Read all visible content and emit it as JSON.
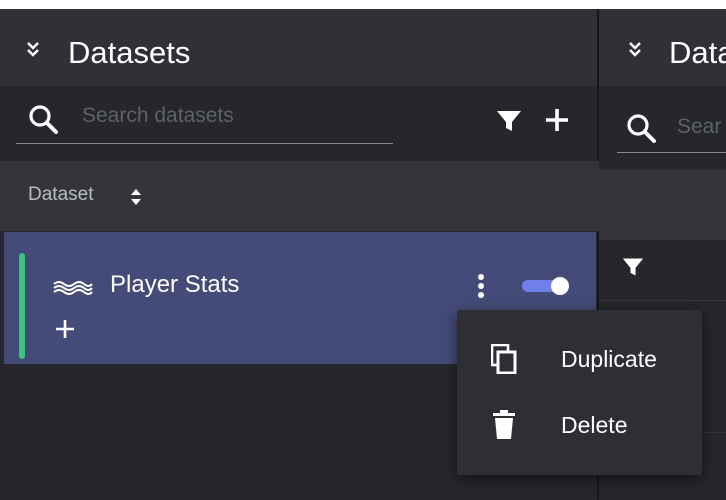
{
  "left_panel": {
    "title": "Datasets",
    "collapse_icon": "chevron-double-down-icon",
    "search": {
      "placeholder": "Search datasets",
      "value": ""
    },
    "column_header": {
      "label": "Dataset",
      "sort_icon": "sort-icon"
    },
    "rows": [
      {
        "label": "Player Stats",
        "icon": "wave-icon",
        "accent_color": "#37c77f",
        "enabled": true,
        "selected": true
      }
    ]
  },
  "right_panel": {
    "title_visible": "Data",
    "search_placeholder_visible": "Sear"
  },
  "context_menu": {
    "items": [
      {
        "label": "Duplicate",
        "icon": "copy-icon"
      },
      {
        "label": "Delete",
        "icon": "trash-icon"
      }
    ]
  },
  "colors": {
    "background": "#1f2126",
    "panel": "#25272c",
    "header": "#2f3136",
    "selected_row": "#454b78",
    "accent": "#37c77f",
    "toggle": "#6f80e8"
  }
}
